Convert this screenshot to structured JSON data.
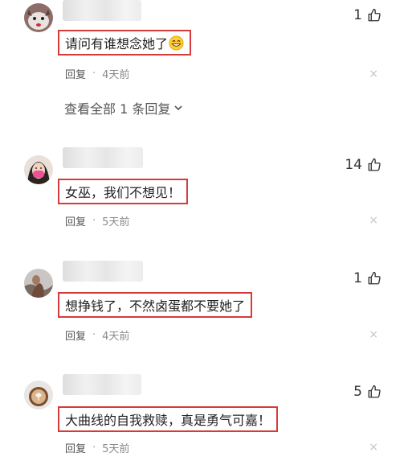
{
  "comments": [
    {
      "likes": "1",
      "text": "请问有谁想念她了",
      "reply_label": "回复",
      "separator": "·",
      "time": "4天前",
      "close": "×",
      "view_replies": "查看全部 1 条回复",
      "avatar_icon": "cat-avatar-icon",
      "emoji_icon": "grinning-face-icon"
    },
    {
      "likes": "14",
      "text": "女巫，我们不想见！",
      "reply_label": "回复",
      "separator": "·",
      "time": "5天前",
      "close": "×",
      "avatar_icon": "woman-mask-avatar-icon"
    },
    {
      "likes": "1",
      "text": "想挣钱了，不然卤蛋都不要她了",
      "reply_label": "回复",
      "separator": "·",
      "time": "4天前",
      "close": "×",
      "avatar_icon": "figure-avatar-icon"
    },
    {
      "likes": "5",
      "text": "大曲线的自我救赎，真是勇气可嘉！",
      "reply_label": "回复",
      "separator": "·",
      "time": "5天前",
      "close": "×",
      "avatar_icon": "coffee-avatar-icon"
    }
  ],
  "colors": {
    "highlight_border": "#d63b3b",
    "text": "#222222",
    "meta": "#8a8a8a"
  },
  "icons": {
    "like": "thumbs-up-icon",
    "expand": "chevron-down-icon"
  }
}
